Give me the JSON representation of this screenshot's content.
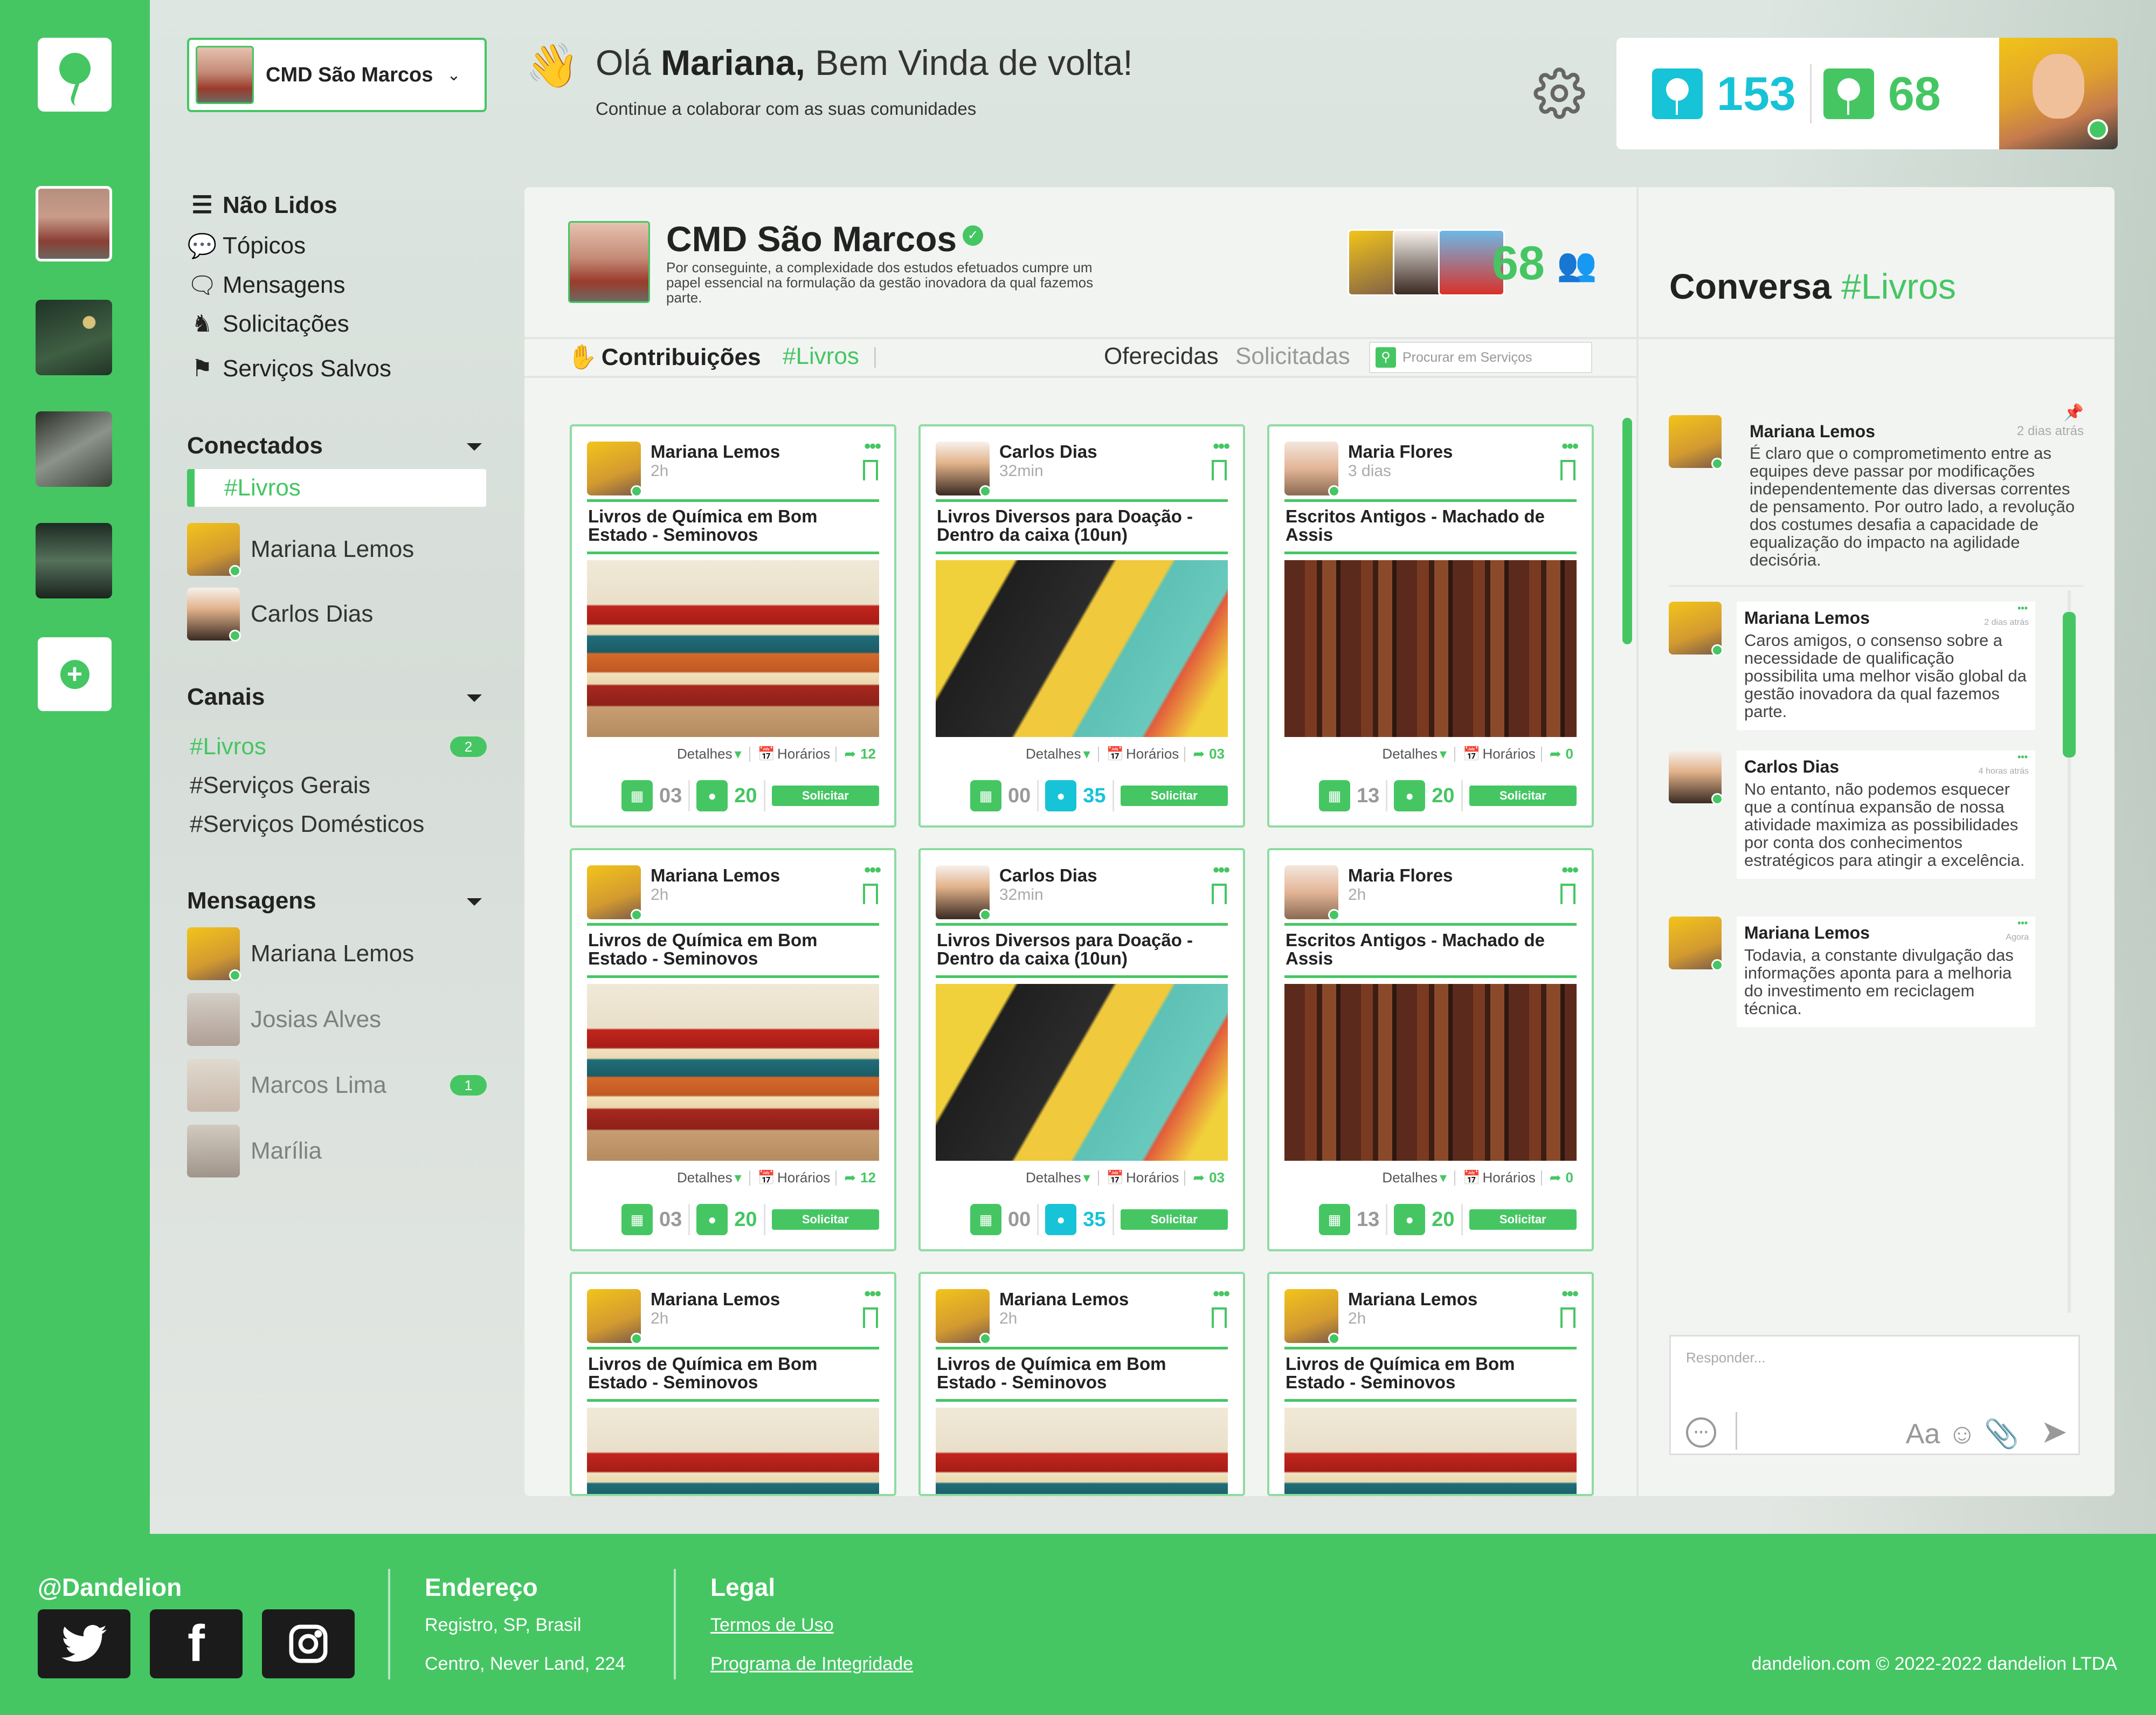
{
  "community": {
    "name": "CMD São Marcos"
  },
  "greeting": {
    "hello": "Olá",
    "name": "Mariana,",
    "rest": "Bem Vinda de volta!",
    "subtitle": "Continue a colaborar com as suas comunidades"
  },
  "stats": {
    "contributions": "153",
    "members": "68"
  },
  "nav": {
    "unread": "Não Lidos",
    "topics": "Tópicos",
    "messages": "Mensagens",
    "requests": "Solicitações",
    "saved": "Serviços Salvos"
  },
  "connected": {
    "title": "Conectados",
    "active": "#Livros",
    "people": [
      "Mariana Lemos",
      "Carlos Dias"
    ]
  },
  "channels": {
    "title": "Canais",
    "items": [
      {
        "name": "#Livros",
        "badge": "2"
      },
      {
        "name": "#Serviços Gerais"
      },
      {
        "name": "#Serviços Domésticos"
      }
    ]
  },
  "dms": {
    "title": "Mensagens",
    "items": [
      {
        "name": "Mariana Lemos"
      },
      {
        "name": "Josias Alves"
      },
      {
        "name": "Marcos Lima",
        "badge": "1"
      },
      {
        "name": "Marília"
      }
    ]
  },
  "header": {
    "title": "CMD São Marcos",
    "description": "Por conseguinte, a complexidade dos estudos efetuados cumpre um papel essencial na formulação da gestão inovadora da qual fazemos parte.",
    "member_count": "68"
  },
  "tabs": {
    "contrib": "Contribuições",
    "channel": "#Livros",
    "offered": "Oferecidas",
    "requested": "Solicitadas",
    "search_placeholder": "Procurar em Serviços"
  },
  "cards": [
    {
      "user": "Mariana Lemos",
      "time": "2h",
      "title": "Livros de Química em Bom Estado - Seminovos",
      "details": "Detalhes",
      "schedule": "Horários",
      "shares": "12",
      "c1": "03",
      "c2": "20",
      "button": "Solicitar"
    },
    {
      "user": "Carlos Dias",
      "time": "32min",
      "title": "Livros Diversos para Doação - Dentro da caixa (10un)",
      "details": "Detalhes",
      "schedule": "Horários",
      "shares": "03",
      "c1": "00",
      "c2": "35",
      "button": "Solicitar"
    },
    {
      "user": "Maria Flores",
      "time": "3 dias",
      "title": "Escritos Antigos - Machado de Assis",
      "details": "Detalhes",
      "schedule": "Horários",
      "shares": "0",
      "c1": "13",
      "c2": "20",
      "button": "Solicitar"
    },
    {
      "user": "Mariana Lemos",
      "time": "2h",
      "title": "Livros de Química em Bom Estado - Seminovos",
      "details": "Detalhes",
      "schedule": "Horários",
      "shares": "12",
      "c1": "03",
      "c2": "20",
      "button": "Solicitar"
    },
    {
      "user": "Carlos Dias",
      "time": "32min",
      "title": "Livros Diversos para Doação - Dentro da caixa (10un)",
      "details": "Detalhes",
      "schedule": "Horários",
      "shares": "03",
      "c1": "00",
      "c2": "35",
      "button": "Solicitar"
    },
    {
      "user": "Maria Flores",
      "time": "2h",
      "title": "Escritos Antigos - Machado de Assis",
      "details": "Detalhes",
      "schedule": "Horários",
      "shares": "0",
      "c1": "13",
      "c2": "20",
      "button": "Solicitar"
    },
    {
      "user": "Mariana Lemos",
      "time": "2h",
      "title": "Livros de Química em Bom Estado - Seminovos"
    },
    {
      "user": "Mariana Lemos",
      "time": "2h",
      "title": "Livros de Química em Bom Estado - Seminovos"
    },
    {
      "user": "Mariana Lemos",
      "time": "2h",
      "title": "Livros de Química em Bom Estado - Seminovos"
    }
  ],
  "conversation": {
    "title": "Conversa",
    "channel": "#Livros",
    "pinned": {
      "user": "Mariana Lemos",
      "time": "2 dias atrás",
      "text": "É claro que o comprometimento entre as equipes deve passar por modificações independentemente das diversas correntes de pensamento. Por outro lado, a revolução dos costumes desafia a capacidade de equalização do impacto na agilidade decisória."
    },
    "messages": [
      {
        "user": "Mariana Lemos",
        "time": "2 dias atrás",
        "text": "Caros amigos, o consenso sobre a necessidade de qualificação possibilita uma melhor visão global da gestão inovadora da qual fazemos parte."
      },
      {
        "user": "Carlos Dias",
        "time": "4 horas atrás",
        "text": "No entanto, não podemos esquecer que a contínua expansão de nossa atividade maximiza as possibilidades por conta dos conhecimentos estratégicos para atingir a excelência."
      },
      {
        "user": "Mariana Lemos",
        "time": "Agora",
        "text": "Todavia, a constante divulgação das informações aponta para a melhoria do investimento em reciclagem técnica."
      }
    ],
    "reply_placeholder": "Responder...",
    "font_tool": "Aa"
  },
  "footer": {
    "brand": "@Dandelion",
    "address_title": "Endereço",
    "address_1": "Registro, SP, Brasil",
    "address_2": "Centro, Never Land, 224",
    "legal_title": "Legal",
    "terms": "Termos de Uso",
    "integrity": "Programa de Integridade",
    "copyright": "dandelion.com © 2022-2022 dandelion LTDA"
  },
  "colors": {
    "accent": "#45c663",
    "cyan": "#17c3d6",
    "muted": "#999999"
  }
}
